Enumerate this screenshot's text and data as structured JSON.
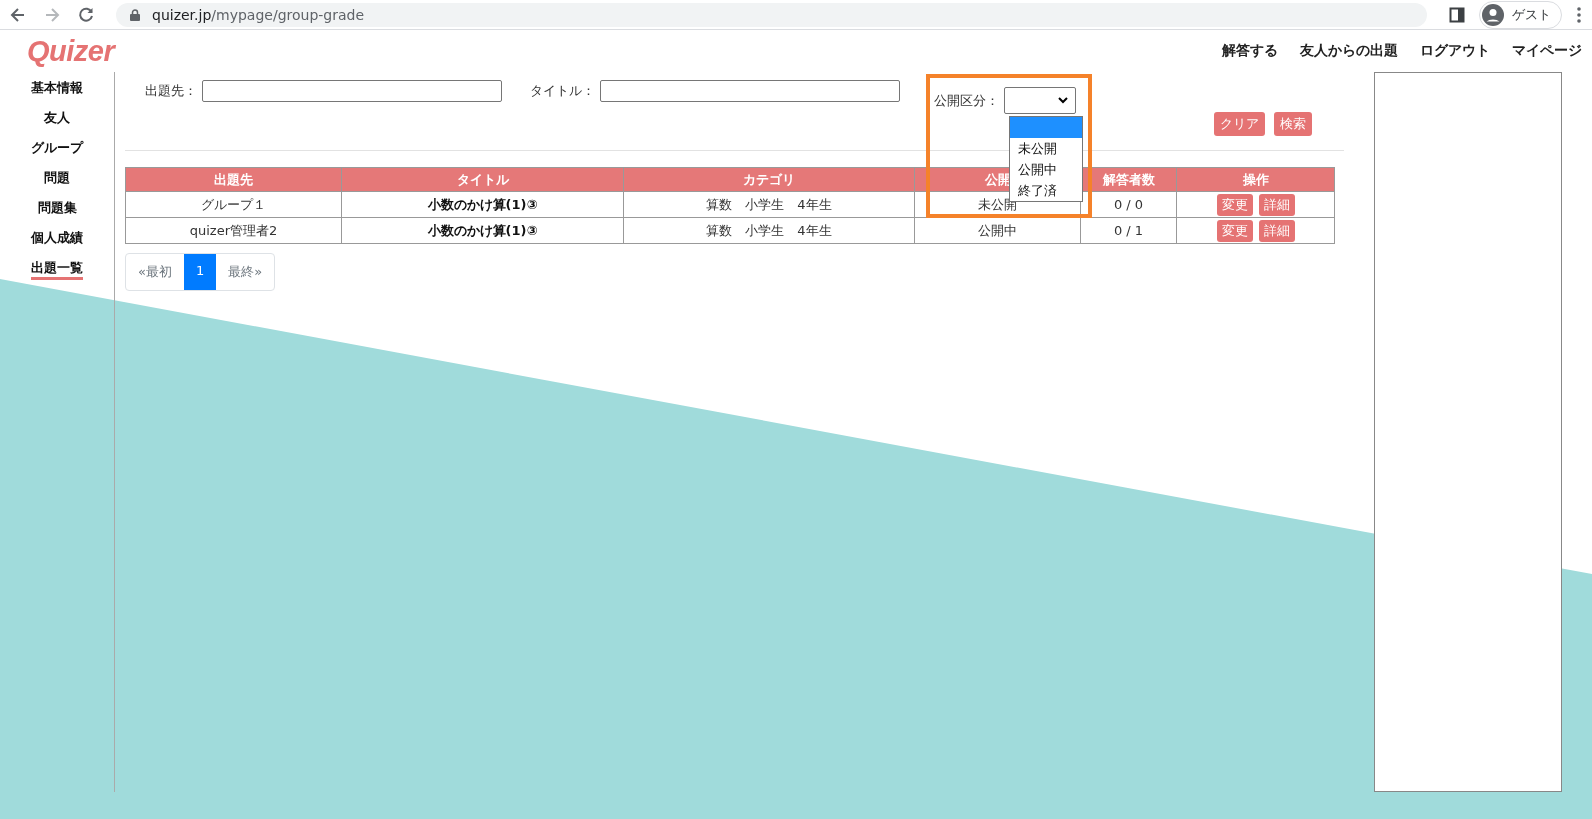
{
  "browser": {
    "url_host": "quizer.jp",
    "url_path": "/mypage/group-grade",
    "forward_disabled": true,
    "profile": "ゲスト"
  },
  "header": {
    "logo": "Quizer",
    "nav": [
      "解答する",
      "友人からの出題",
      "ログアウト",
      "マイページ"
    ]
  },
  "sidebar": {
    "items": [
      {
        "label": "基本情報",
        "selected": false
      },
      {
        "label": "友人",
        "selected": false
      },
      {
        "label": "グループ",
        "selected": false
      },
      {
        "label": "問題",
        "selected": false
      },
      {
        "label": "問題集",
        "selected": false
      },
      {
        "label": "個人成績",
        "selected": false
      },
      {
        "label": "出題一覧",
        "selected": true
      }
    ]
  },
  "filters": {
    "fields": [
      {
        "label": "出題先："
      },
      {
        "label": "タイトル："
      }
    ],
    "status": {
      "label": "公開区分：",
      "highlighted": true,
      "dropdown": {
        "open": true,
        "blank_highlighted": true,
        "options": [
          {
            "label": "未公開",
            "selected": false
          },
          {
            "label": "公開中",
            "selected": false
          },
          {
            "label": "終了済",
            "selected": false
          }
        ]
      }
    },
    "buttons": [
      "クリア",
      "検索"
    ]
  },
  "table": {
    "columns": [
      "出題先",
      "タイトル",
      "カテゴリ",
      "公開",
      "解答者数",
      "操作"
    ],
    "rows": [
      {
        "cells": [
          "グループ１",
          "小数のかけ算(1)③",
          "算数　小学生　4年生",
          "未公開",
          "0 / 0"
        ],
        "actions": [
          "変更",
          "詳細"
        ]
      },
      {
        "cells": [
          "quizer管理者2",
          "小数のかけ算(1)③",
          "算数　小学生　4年生",
          "公開中",
          "0 / 1"
        ],
        "actions": [
          "変更",
          "詳細"
        ]
      }
    ]
  },
  "pagination": {
    "first": "«最初",
    "pages": [
      {
        "label": "1",
        "selected": true
      }
    ],
    "last": "最終»"
  }
}
